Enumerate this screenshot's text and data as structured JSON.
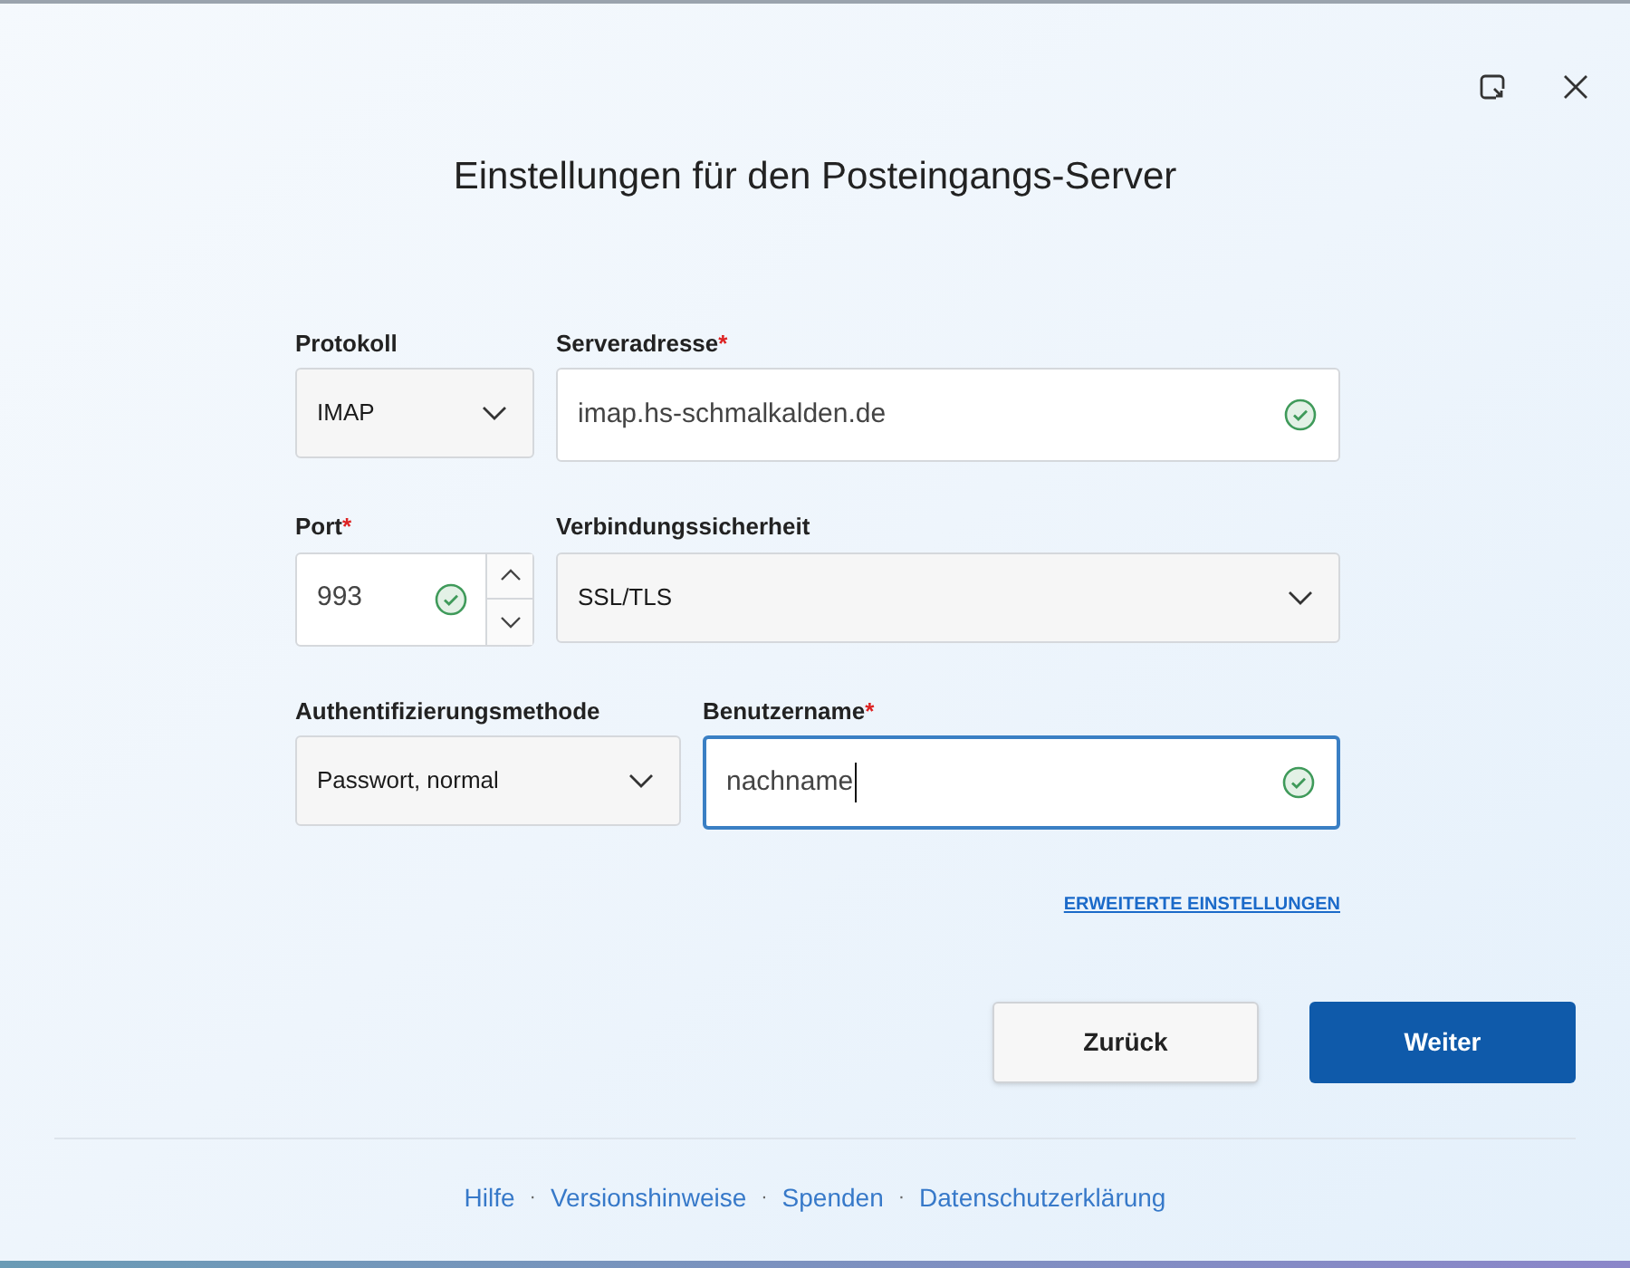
{
  "title": "Einstellungen für den Posteingangs-Server",
  "rows": [
    {
      "fields": [
        {
          "kind": "select",
          "label": "Protokoll",
          "value": "IMAP"
        },
        {
          "kind": "text",
          "label": "Serveradresse",
          "required_mark": "*",
          "value": "imap.hs-schmalkalden.de",
          "valid": true,
          "focused": false
        }
      ]
    },
    {
      "fields": [
        {
          "kind": "spin",
          "label": "Port",
          "required_mark": "*",
          "value": "993",
          "valid": true,
          "focused": false
        },
        {
          "kind": "select",
          "label": "Verbindungssicherheit",
          "value": "SSL/TLS"
        }
      ]
    },
    {
      "fields": [
        {
          "kind": "select",
          "label": "Authentifizierungsmethode",
          "value": "Passwort, normal"
        },
        {
          "kind": "text",
          "label": "Benutzername",
          "required_mark": "*",
          "value": "nachname",
          "valid": true,
          "focused": true
        }
      ]
    }
  ],
  "advanced_link": "ERWEITERTE EINSTELLUNGEN",
  "buttons": [
    {
      "label": "Zurück",
      "primary": false
    },
    {
      "label": "Weiter",
      "primary": true
    }
  ],
  "footer": [
    {
      "kind": "link",
      "text": "Hilfe"
    },
    {
      "kind": "separator",
      "text": "·"
    },
    {
      "kind": "link",
      "text": "Versionshinweise"
    },
    {
      "kind": "separator",
      "text": "·"
    },
    {
      "kind": "link",
      "text": "Spenden"
    },
    {
      "kind": "separator",
      "text": "·"
    },
    {
      "kind": "link",
      "text": "Datenschutzerklärung"
    }
  ]
}
